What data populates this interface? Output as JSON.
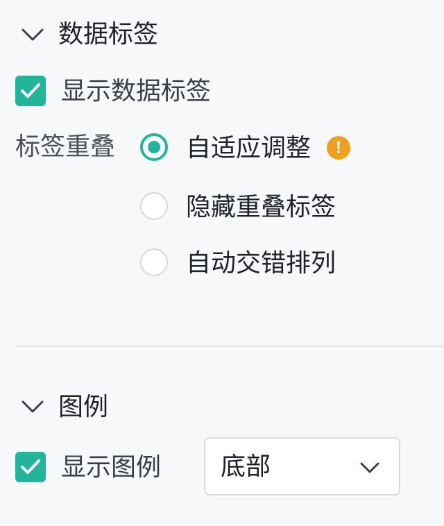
{
  "colors": {
    "accent": "#24b39b",
    "warning": "#f0a020",
    "background": "#f7f8fa"
  },
  "data_labels_section": {
    "title": "数据标签",
    "show_checkbox": {
      "label": "显示数据标签",
      "checked": true
    },
    "overlap": {
      "label": "标签重叠",
      "options": [
        {
          "label": "自适应调整",
          "selected": true,
          "icon": "warning-icon"
        },
        {
          "label": "隐藏重叠标签",
          "selected": false
        },
        {
          "label": "自动交错排列",
          "selected": false
        }
      ]
    }
  },
  "legend_section": {
    "title": "图例",
    "show_checkbox": {
      "label": "显示图例",
      "checked": true
    },
    "position_select": {
      "value": "底部"
    }
  }
}
